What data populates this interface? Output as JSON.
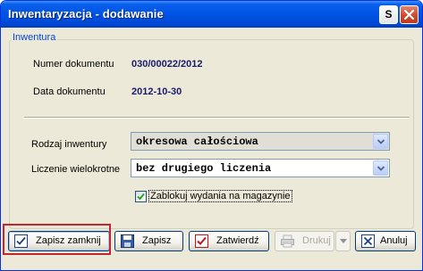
{
  "window": {
    "title": "Inwentaryzacja - dodawanie",
    "s_button": "S"
  },
  "group": {
    "title": "Inwentura"
  },
  "fields": {
    "numer_label": "Numer dokumentu",
    "numer_value": "030/00022/2012",
    "data_label": "Data dokumentu",
    "data_value": "2012-10-30",
    "rodzaj_label": "Rodzaj inwentury",
    "rodzaj_value": "okresowa całościowa",
    "liczenie_label": "Liczenie wielokrotne",
    "liczenie_value": "bez drugiego liczenia"
  },
  "checkbox": {
    "label": "Zablokuj wydania na magazynie",
    "checked": true
  },
  "buttons": {
    "zapisz_zamknij": "Zapisz zamknij",
    "zapisz": "Zapisz",
    "zatwierdz": "Zatwierdź",
    "drukuj": "Drukuj",
    "anuluj": "Anuluj"
  },
  "icons": {
    "zapisz_zamknij": "check-icon",
    "zapisz": "floppy-disk-icon",
    "zatwierdz": "checkmark-icon",
    "drukuj": "printer-icon",
    "anuluj": "close-icon"
  },
  "colors": {
    "titlebar": "#0054e3",
    "group_title": "#0046d5",
    "highlight": "#c4262e"
  }
}
